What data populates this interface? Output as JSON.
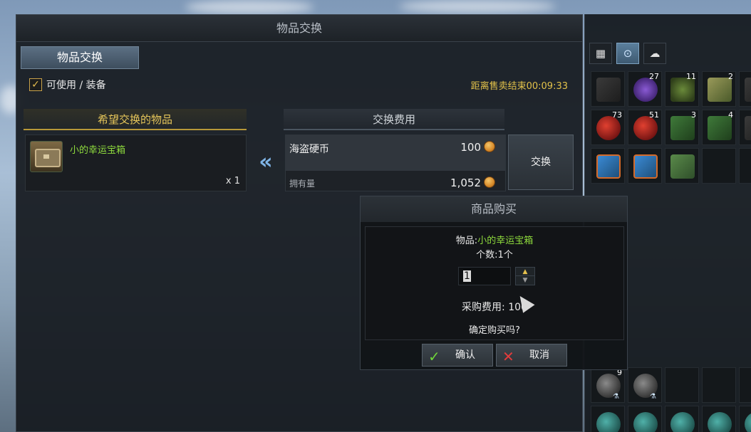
{
  "window": {
    "title": "物品交换",
    "tab_label": "物品交换",
    "filter_label": "可使用 / 装备",
    "filter_checked": true,
    "timer": "距离售卖结束00:09:33"
  },
  "want": {
    "header": "希望交换的物品",
    "item_name": "小的幸运宝箱",
    "item_qty": "x 1"
  },
  "cost": {
    "header": "交换费用",
    "currency_name": "海盗硬币",
    "amount": "100",
    "own_label": "拥有量",
    "own_amount": "1,052",
    "exchange_button": "交换"
  },
  "dialog": {
    "title": "商品购买",
    "item_prefix": "物品:",
    "item_name": "小的幸运宝箱",
    "count_text": "个数:1个",
    "quantity_value": "1",
    "cost_text": "采购费用: 100",
    "confirm_question": "确定购买吗?",
    "ok_label": "确认",
    "cancel_label": "取消"
  },
  "inventory": {
    "tabs": [
      "grid-icon",
      "bag-icon",
      "cloud-icon"
    ],
    "slots": [
      {
        "art": "dark",
        "count": ""
      },
      {
        "art": "purple",
        "count": "27"
      },
      {
        "art": "herb",
        "count": "11"
      },
      {
        "art": "leaf",
        "count": "2"
      },
      {
        "art": "dark",
        "count": ""
      },
      {
        "art": "red",
        "count": "73"
      },
      {
        "art": "red",
        "count": "51"
      },
      {
        "art": "green",
        "count": "3"
      },
      {
        "art": "green",
        "count": "4"
      },
      {
        "art": "dark",
        "count": ""
      },
      {
        "art": "gift",
        "count": ""
      },
      {
        "art": "gift",
        "count": ""
      },
      {
        "art": "map",
        "count": ""
      },
      {
        "art": "",
        "count": ""
      },
      {
        "art": "",
        "count": ""
      }
    ],
    "lower_slots": [
      {
        "art": "orb",
        "count": "9"
      },
      {
        "art": "orb",
        "count": ""
      },
      {
        "art": "",
        "count": ""
      },
      {
        "art": "",
        "count": ""
      },
      {
        "art": "",
        "count": ""
      },
      {
        "art": "teal",
        "count": ""
      },
      {
        "art": "teal",
        "count": ""
      },
      {
        "art": "teal",
        "count": ""
      },
      {
        "art": "teal",
        "count": ""
      },
      {
        "art": "teal",
        "count": ""
      }
    ]
  }
}
